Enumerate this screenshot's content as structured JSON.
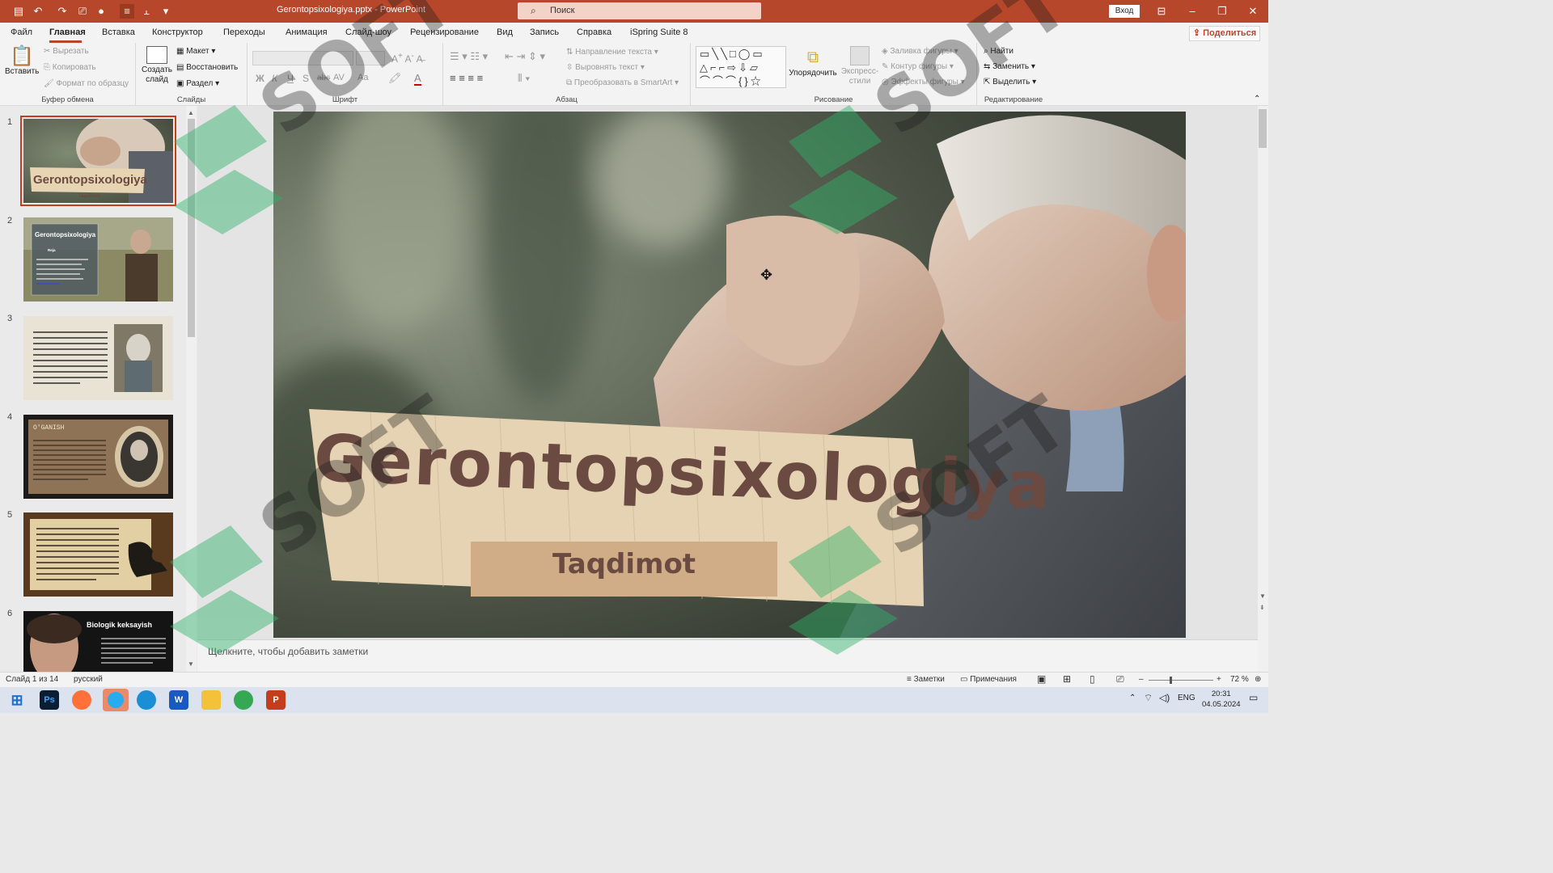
{
  "titlebar": {
    "doc_title": "Gerontopsixologiya.pptx  -  PowerPoint",
    "search_placeholder": "Поиск",
    "signin": "Вход"
  },
  "menu": {
    "items": [
      "Файл",
      "Главная",
      "Вставка",
      "Конструктор",
      "Переходы",
      "Анимация",
      "Слайд-шоу",
      "Рецензирование",
      "Вид",
      "Запись",
      "Справка",
      "iSpring Suite 8"
    ],
    "active": "Главная",
    "share": "Поделиться"
  },
  "ribbon": {
    "clipboard": {
      "paste": "Вставить",
      "cut": "Вырезать",
      "copy": "Копировать",
      "format": "Формат по образцу",
      "label": "Буфер обмена"
    },
    "slides": {
      "new_slide": "Создать слайд",
      "layout": "Макет",
      "reset": "Восстановить",
      "section": "Раздел",
      "label": "Слайды"
    },
    "font": {
      "label": "Шрифт",
      "bold": "Ж",
      "italic": "К",
      "underline": "Ч",
      "shadow": "S",
      "strike": "abc",
      "case": "Aa"
    },
    "paragraph": {
      "direction": "Направление текста",
      "align": "Выровнять текст",
      "smartart": "Преобразовать в SmartArt",
      "label": "Абзац"
    },
    "drawing": {
      "arrange": "Упорядочить",
      "quick_styles": "Экспресс-стили",
      "fill": "Заливка фигуры",
      "outline": "Контур фигуры",
      "effects": "Эффекты фигуры",
      "label": "Рисование"
    },
    "editing": {
      "find": "Найти",
      "replace": "Заменить",
      "select": "Выделить",
      "label": "Редактирование"
    }
  },
  "thumbnails": [
    {
      "num": "1",
      "title": "Gerontopsixologiya",
      "sub": "Taqdimot"
    },
    {
      "num": "2",
      "title": "Gerontopsixologiya",
      "sub": "Reja"
    },
    {
      "num": "3",
      "title": ""
    },
    {
      "num": "4",
      "title": "O'GANISH"
    },
    {
      "num": "5",
      "title": ""
    },
    {
      "num": "6",
      "title": "Biologik keksayish"
    }
  ],
  "slide": {
    "title": "Gerontopsixologiya",
    "subtitle": "Taqdimot"
  },
  "notes_placeholder": "Щелкните, чтобы добавить заметки",
  "status": {
    "slide_count": "Слайд 1 из 14",
    "language": "русский",
    "notes": "Заметки",
    "comments": "Примечания",
    "zoom": "72 %"
  },
  "taskbar": {
    "lang": "ENG",
    "time": "20:31",
    "date": "04.05.2024",
    "apps": [
      "Ps",
      "Firefox",
      "Telegram",
      "Edge",
      "W",
      "Explorer",
      "Chrome",
      "P"
    ]
  },
  "colors": {
    "accent": "#b7472a",
    "title_text": "#6b4a42",
    "paper": "#e6d3b3",
    "watermark_green": "#2fb36a"
  }
}
